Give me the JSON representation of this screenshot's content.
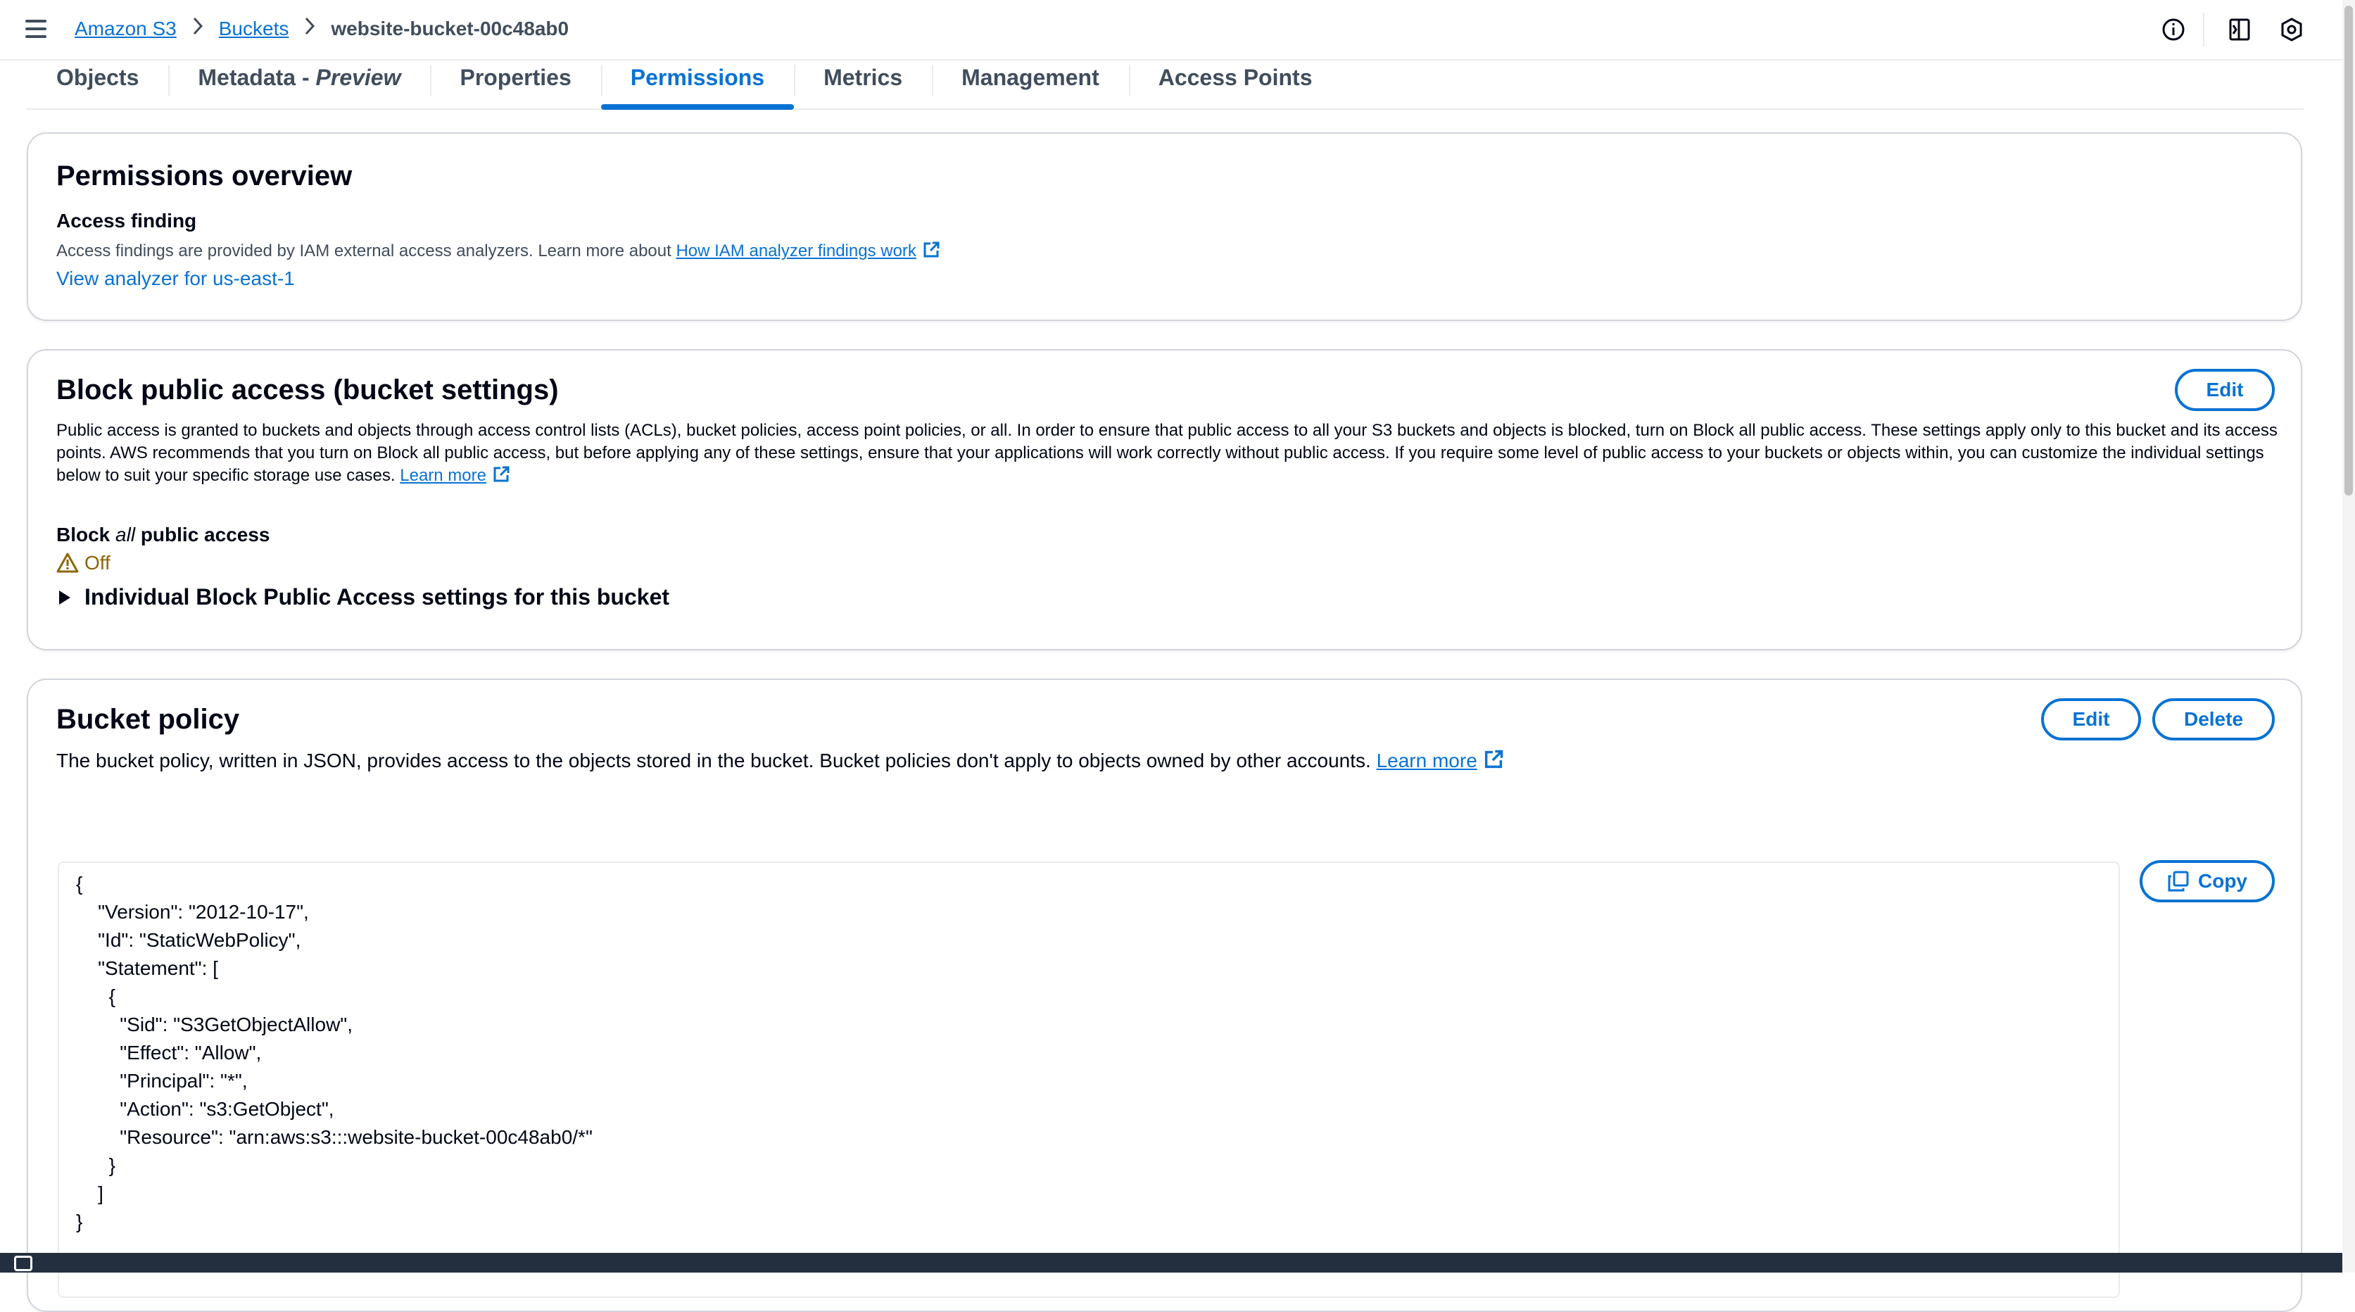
{
  "breadcrumb": {
    "root": "Amazon S3",
    "buckets": "Buckets",
    "current": "website-bucket-00c48ab0"
  },
  "tabs": [
    {
      "label": "Objects"
    },
    {
      "label": "Metadata - ",
      "suffix": "Preview"
    },
    {
      "label": "Properties"
    },
    {
      "label": "Permissions",
      "active": true
    },
    {
      "label": "Metrics"
    },
    {
      "label": "Management"
    },
    {
      "label": "Access Points"
    }
  ],
  "overview": {
    "title": "Permissions overview",
    "subtitle": "Access finding",
    "description": "Access findings are provided by IAM external access analyzers. Learn more about ",
    "link": "How IAM analyzer findings work",
    "analyzer_link": "View analyzer for us-east-1"
  },
  "block_public_access": {
    "title": "Block public access (bucket settings)",
    "edit_label": "Edit",
    "description": "Public access is granted to buckets and objects through access control lists (ACLs), bucket policies, access point policies, or all. In order to ensure that public access to all your S3 buckets and objects is blocked, turn on Block all public access. These settings apply only to this bucket and its access points. AWS recommends that you turn on Block all public access, but before applying any of these settings, ensure that your applications will work correctly without public access. If you require some level of public access to your buckets or objects within, you can customize the individual settings below to suit your specific storage use cases. ",
    "learn_more": "Learn more",
    "label_prefix": "Block ",
    "label_em": "all",
    "label_suffix": " public access",
    "status": "Off",
    "status_color": "#8d6605",
    "expander": "Individual Block Public Access settings for this bucket"
  },
  "bucket_policy": {
    "title": "Bucket policy",
    "edit_label": "Edit",
    "delete_label": "Delete",
    "copy_label": "Copy",
    "description": "The bucket policy, written in JSON, provides access to the objects stored in the bucket. Bucket policies don't apply to objects owned by other accounts. ",
    "learn_more": "Learn more",
    "policy_text": "{\n    \"Version\": \"2012-10-17\",\n    \"Id\": \"StaticWebPolicy\",\n    \"Statement\": [\n      {\n        \"Sid\": \"S3GetObjectAllow\",\n        \"Effect\": \"Allow\",\n        \"Principal\": \"*\",\n        \"Action\": \"s3:GetObject\",\n        \"Resource\": \"arn:aws:s3:::website-bucket-00c48ab0/*\"\n      }\n    ]\n}"
  },
  "colors": {
    "link": "#0972d3",
    "warning": "#8d6605",
    "footer": "#232f3e"
  }
}
